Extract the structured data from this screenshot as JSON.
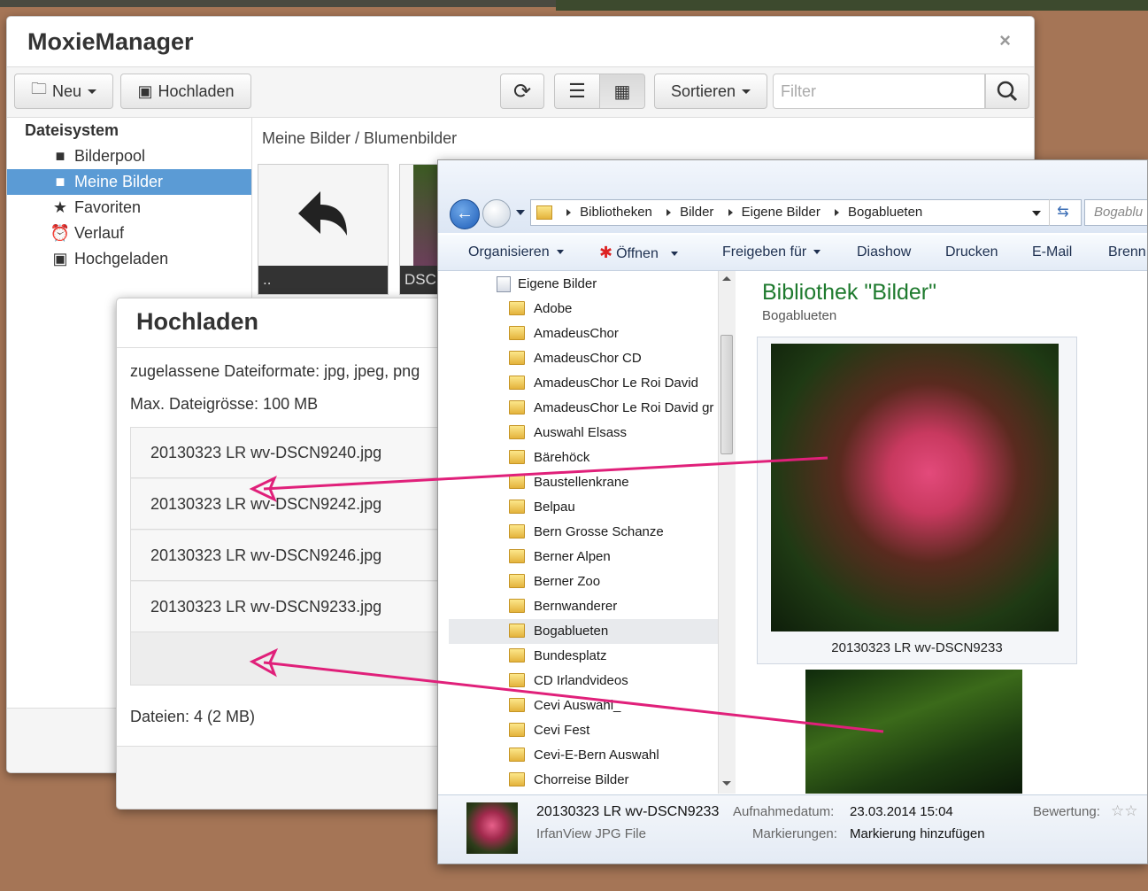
{
  "moxie": {
    "title": "MoxieManager",
    "close": "×",
    "toolbar": {
      "new_label": "Neu",
      "upload_label": "Hochladen",
      "sort_label": "Sortieren",
      "filter_placeholder": "Filter"
    },
    "sidebar": {
      "header": "Dateisystem",
      "items": [
        {
          "label": "Bilderpool",
          "icon": "folder-icon"
        },
        {
          "label": "Meine Bilder",
          "icon": "folder-open-icon"
        },
        {
          "label": "Favoriten",
          "icon": "star-icon"
        },
        {
          "label": "Verlauf",
          "icon": "alarm-clock-icon"
        },
        {
          "label": "Hochgeladen",
          "icon": "inbox-upload-icon"
        }
      ]
    },
    "breadcrumb": "Meine Bilder / Blumenbilder",
    "thumbs": [
      {
        "caption": ".."
      },
      {
        "caption": "DSC"
      }
    ]
  },
  "upload": {
    "title": "Hochladen",
    "formats": "zugelassene Dateiformate: jpg, jpeg, png",
    "maxsize": "Max. Dateigrösse: 100 MB",
    "files": [
      "20130323 LR wv-DSCN9240.jpg",
      "20130323 LR wv-DSCN9242.jpg",
      "20130323 LR wv-DSCN9246.jpg",
      "20130323 LR wv-DSCN9233.jpg"
    ],
    "summary": "Dateien: 4 (2 MB)"
  },
  "explorer": {
    "address": [
      "Bibliotheken",
      "Bilder",
      "Eigene Bilder",
      "Bogablueten"
    ],
    "search_placeholder": "Bogablu",
    "commands": [
      "Organisieren",
      "Öffnen",
      "Freigeben für",
      "Diashow",
      "Drucken",
      "E-Mail",
      "Brenn"
    ],
    "tree_root": "Eigene Bilder",
    "tree": [
      "Adobe",
      "AmadeusChor",
      "AmadeusChor CD",
      "AmadeusChor Le Roi David",
      "AmadeusChor Le Roi David gr",
      "Auswahl Elsass",
      "Bärehöck",
      "Baustellenkrane",
      "Belpau",
      "Bern Grosse Schanze",
      "Berner Alpen",
      "Berner Zoo",
      "Bernwanderer",
      "Bogablueten",
      "Bundesplatz",
      "CD Irlandvideos",
      "Cevi Auswahl_",
      "Cevi Fest",
      "Cevi-E-Bern Auswahl",
      "Chorreise Bilder"
    ],
    "selected_folder": "Bogablueten",
    "library_title": "Bibliothek \"Bilder\"",
    "library_sub": "Bogablueten",
    "photo_caption": "20130323 LR wv-DSCN9233",
    "details": {
      "name": "20130323 LR wv-DSCN9233",
      "type": "IrfanView JPG File",
      "date_label": "Aufnahmedatum:",
      "date_value": "23.03.2014 15:04",
      "tags_label": "Markierungen:",
      "tags_value": "Markierung hinzufügen",
      "rating_label": "Bewertung:"
    }
  },
  "colors": {
    "desktop": "#a57556",
    "selection": "#5b9bd5",
    "arrow": "#e0207a",
    "library_title": "#1e7a2e"
  }
}
